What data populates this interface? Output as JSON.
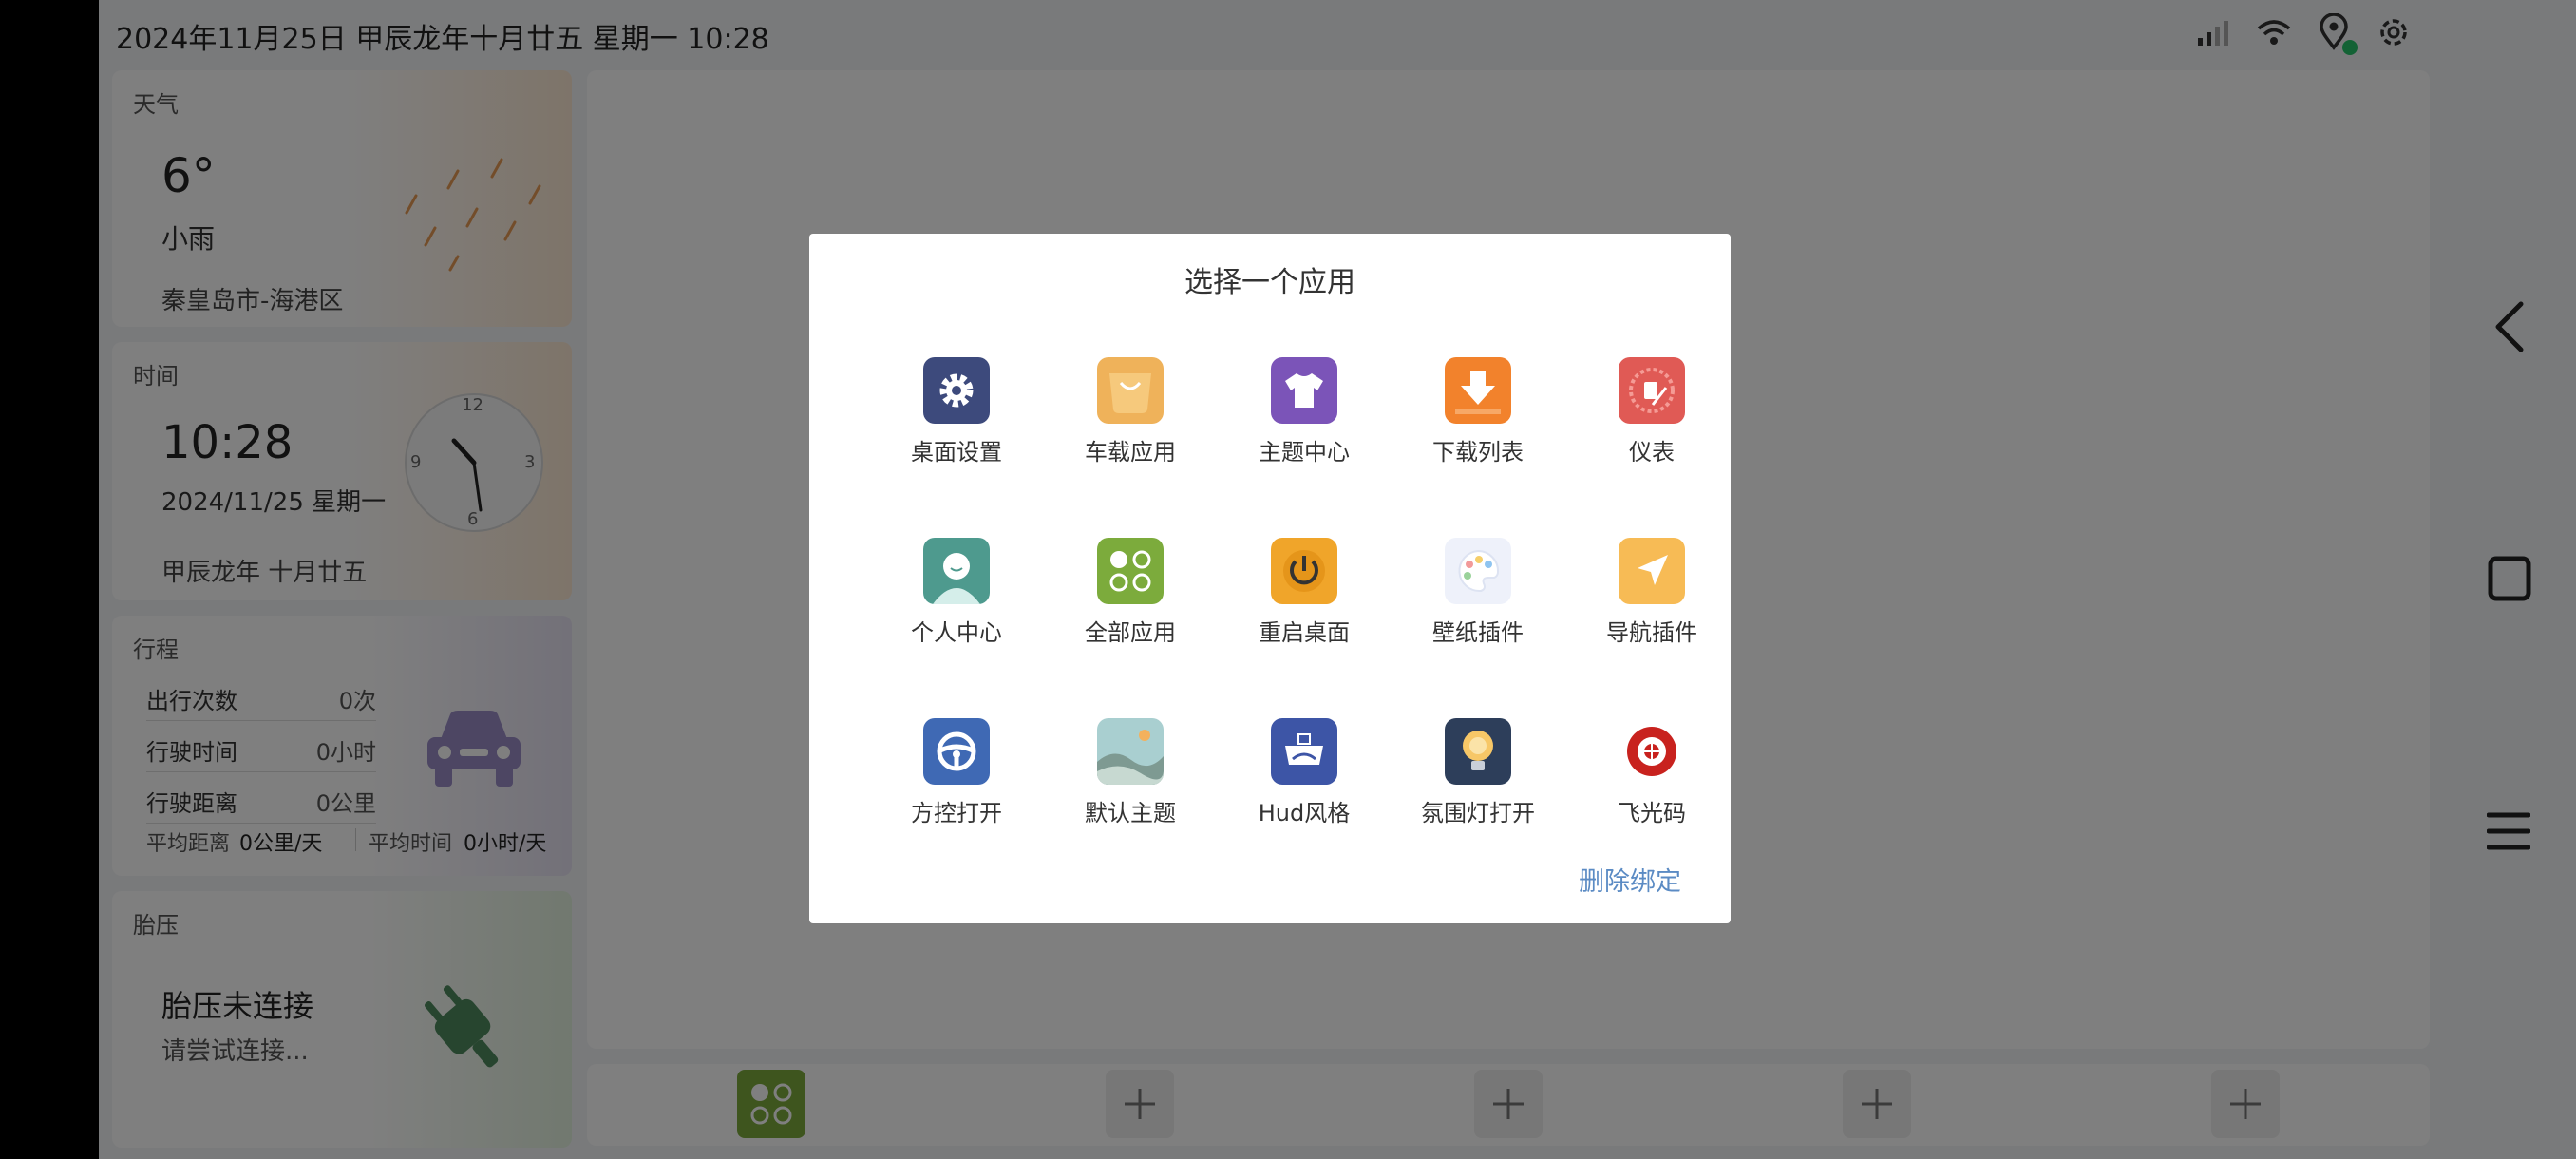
{
  "status_bar": {
    "datetime": "2024年11月25日  甲辰龙年十月廿五  星期一  10:28",
    "icons": [
      "signal-icon",
      "wifi-icon",
      "location-icon",
      "settings-icon"
    ],
    "dot_color": "#27c46a"
  },
  "weather": {
    "title": "天气",
    "temperature": "6°",
    "condition": "小雨",
    "location": "秦皇岛市-海港区"
  },
  "time_card": {
    "title": "时间",
    "time": "10:28",
    "date": "2024/11/25 星期一",
    "lunar": "甲辰龙年 十月廿五",
    "clock_numbers": [
      "12",
      "3",
      "6",
      "9"
    ]
  },
  "trip": {
    "title": "行程",
    "rows": [
      {
        "label": "出行次数",
        "value": "0次"
      },
      {
        "label": "行驶时间",
        "value": "0小时"
      },
      {
        "label": "行驶距离",
        "value": "0公里"
      }
    ],
    "avg_distance_label": "平均距离",
    "avg_distance_value": "0公里/天",
    "avg_time_label": "平均时间",
    "avg_time_value": "0小时/天"
  },
  "tire": {
    "title": "胎压",
    "status": "胎压未连接",
    "hint": "请尝试连接..."
  },
  "dialog": {
    "title": "选择一个应用",
    "apps": [
      {
        "label": "桌面设置",
        "icon": "gear-icon",
        "color": "#3d4a7c"
      },
      {
        "label": "车载应用",
        "icon": "bag-icon",
        "color": "#efb25a"
      },
      {
        "label": "主题中心",
        "icon": "tshirt-icon",
        "color": "#7b54b8"
      },
      {
        "label": "下载列表",
        "icon": "download-icon",
        "color": "#f2822c"
      },
      {
        "label": "仪表",
        "icon": "gauge-icon",
        "color": "#e05a55"
      },
      {
        "label": "个人中心",
        "icon": "user-icon",
        "color": "#4e9a8e"
      },
      {
        "label": "全部应用",
        "icon": "grid-icon",
        "color": "#7cab3c"
      },
      {
        "label": "重启桌面",
        "icon": "power-icon",
        "color": "#f0a52a"
      },
      {
        "label": "壁纸插件",
        "icon": "palette-icon",
        "color": "#eef1fa"
      },
      {
        "label": "导航插件",
        "icon": "navigation-icon",
        "color": "#f7bb55"
      },
      {
        "label": "方控打开",
        "icon": "steering-wheel-icon",
        "color": "#3f69b4"
      },
      {
        "label": "默认主题",
        "icon": "landscape-icon",
        "color": "#a9cfd0"
      },
      {
        "label": "Hud风格",
        "icon": "hud-icon",
        "color": "#3d55a6"
      },
      {
        "label": "氛围灯打开",
        "icon": "bulb-icon",
        "color": "#2d3e5a"
      },
      {
        "label": "飞光码",
        "icon": "target-icon",
        "color": "#ffffff"
      }
    ],
    "unbind_label": "删除绑定"
  },
  "dock": {
    "slots": [
      "apps",
      "add",
      "add",
      "add",
      "add"
    ]
  },
  "nav": {
    "icons": [
      "back-icon",
      "home-icon",
      "menu-icon"
    ]
  }
}
